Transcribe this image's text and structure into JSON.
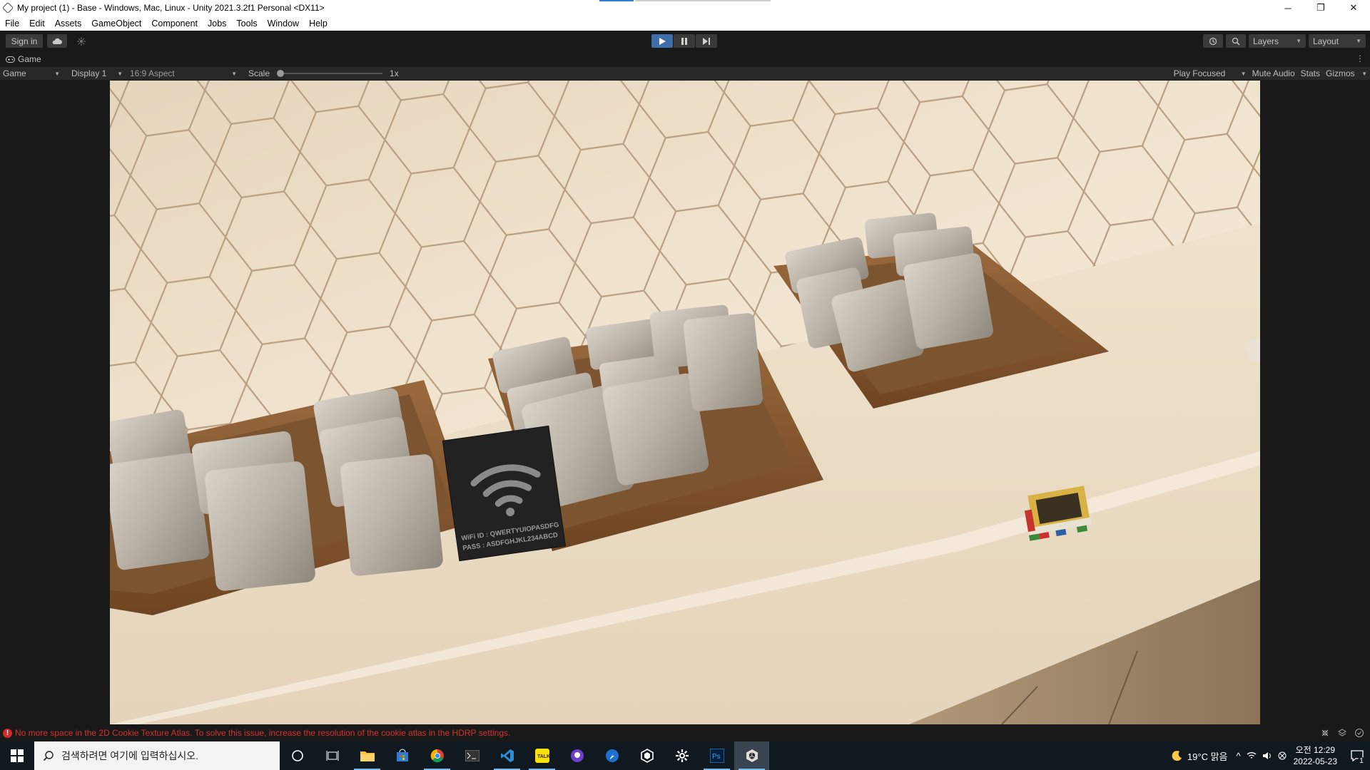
{
  "window": {
    "title": "My project (1) - Base - Windows, Mac, Linux - Unity 2021.3.2f1 Personal <DX11>",
    "minimize": "─",
    "maximize": "❐",
    "close": "✕"
  },
  "menu": [
    "File",
    "Edit",
    "Assets",
    "GameObject",
    "Component",
    "Jobs",
    "Tools",
    "Window",
    "Help"
  ],
  "toolbar": {
    "sign_in": "Sign in",
    "layers": "Layers",
    "layout": "Layout"
  },
  "game_tab": {
    "label": "Game"
  },
  "game_bar": {
    "mode": "Game",
    "display": "Display 1",
    "aspect": "16:9 Aspect",
    "scale_label": "Scale",
    "scale_value": "1x",
    "play_focused": "Play Focused",
    "mute_audio": "Mute Audio",
    "stats": "Stats",
    "gizmos": "Gizmos"
  },
  "scene": {
    "sign_line1": "WiFi ID : QWERTYUIOPASDFG",
    "sign_line2": "PASS : ASDFGHJKL234ABCD"
  },
  "status": {
    "message": "No more space in the 2D Cookie Texture Atlas. To solve this issue, increase the resolution of the cookie atlas in the HDRP settings."
  },
  "taskbar": {
    "search_placeholder": "검색하려면 여기에 입력하십시오.",
    "weather": "19°C  맑음",
    "time": "오전 12:29",
    "date": "2022-05-23",
    "notification_count": "1"
  },
  "colors": {
    "accent": "#3f6fa8",
    "error": "#d23333",
    "taskbar": "#101820"
  }
}
